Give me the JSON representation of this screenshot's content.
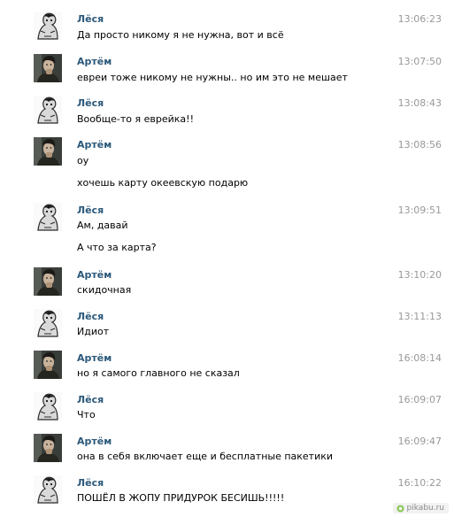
{
  "messages": [
    {
      "author": "Лёся",
      "time": "13:06:23",
      "avatar": "lesya-avatar",
      "lines": [
        "Да просто никому я не нужна, вот и всё"
      ]
    },
    {
      "author": "Артём",
      "time": "13:07:50",
      "avatar": "artem-avatar",
      "lines": [
        "евреи тоже никому не нужны.. но им это не мешает"
      ]
    },
    {
      "author": "Лёся",
      "time": "13:08:43",
      "avatar": "lesya-avatar",
      "lines": [
        "Вообще-то я еврейка!!"
      ]
    },
    {
      "author": "Артём",
      "time": "13:08:56",
      "avatar": "artem-avatar",
      "lines": [
        "оу",
        "хочешь карту океевскую подарю"
      ]
    },
    {
      "author": "Лёся",
      "time": "13:09:51",
      "avatar": "lesya-avatar",
      "lines": [
        "Ам, давай",
        "А что за карта?"
      ]
    },
    {
      "author": "Артём",
      "time": "13:10:20",
      "avatar": "artem-avatar",
      "lines": [
        "скидочная"
      ]
    },
    {
      "author": "Лёся",
      "time": "13:11:13",
      "avatar": "lesya-avatar",
      "lines": [
        "Идиот"
      ]
    },
    {
      "author": "Артём",
      "time": "16:08:14",
      "avatar": "artem-avatar",
      "lines": [
        "но я самого главного не сказал"
      ]
    },
    {
      "author": "Лёся",
      "time": "16:09:07",
      "avatar": "lesya-avatar",
      "lines": [
        "Что"
      ]
    },
    {
      "author": "Артём",
      "time": "16:09:47",
      "avatar": "artem-avatar",
      "lines": [
        "она в себя включает еще и бесплатные пакетики"
      ]
    },
    {
      "author": "Лёся",
      "time": "16:10:22",
      "avatar": "lesya-avatar",
      "lines": [
        "ПОШЁЛ В ЖОПУ ПРИДУРОК БЕСИШЬ!!!!!"
      ]
    }
  ],
  "watermark": {
    "text": "pikabu.ru",
    "icon": "pikabu-logo-icon"
  },
  "colors": {
    "author_link": "#2b587a",
    "timestamp": "#999999",
    "message_text": "#000000",
    "background": "#ffffff"
  }
}
